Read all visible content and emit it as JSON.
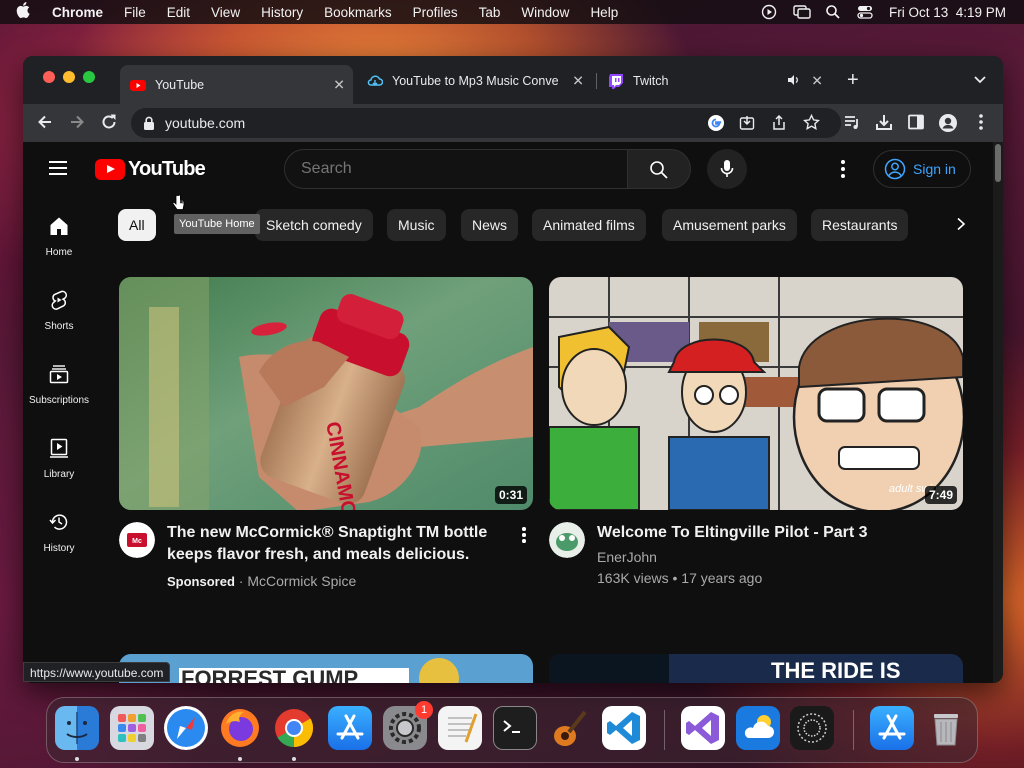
{
  "menubar": {
    "app": "Chrome",
    "items": [
      "File",
      "Edit",
      "View",
      "History",
      "Bookmarks",
      "Profiles",
      "Tab",
      "Window",
      "Help"
    ],
    "clock": "Fri Oct 13  4:19 PM"
  },
  "tabs": [
    {
      "title": "YouTube",
      "icon": "youtube-icon",
      "active": true
    },
    {
      "title": "YouTube to Mp3 Music Conve",
      "icon": "cloud-download-icon",
      "active": false
    },
    {
      "title": "Twitch",
      "icon": "twitch-icon",
      "active": false,
      "audio": true
    }
  ],
  "toolbar": {
    "url": "youtube.com"
  },
  "youtube": {
    "logo_text": "YouTube",
    "search_placeholder": "Search",
    "sign_in": "Sign in",
    "sidebar": [
      {
        "label": "Home",
        "icon": "home-icon"
      },
      {
        "label": "Shorts",
        "icon": "shorts-icon"
      },
      {
        "label": "Subscriptions",
        "icon": "subscriptions-icon"
      },
      {
        "label": "Library",
        "icon": "library-icon"
      },
      {
        "label": "History",
        "icon": "history-icon"
      }
    ],
    "chips": [
      "All",
      "Sketch comedy",
      "Music",
      "News",
      "Animated films",
      "Amusement parks",
      "Restaurants"
    ],
    "tooltip": "YouTube Home",
    "videos": [
      {
        "title": "The new McCormick® Snaptight TM bottle keeps flavor fresh, and meals delicious.",
        "duration": "0:31",
        "sponsored": "Sponsored",
        "channel": "McCormick Spice",
        "thumb_text": "CINNAMON"
      },
      {
        "title": "Welcome To Eltingville Pilot - Part 3",
        "duration": "7:49",
        "channel": "EnerJohn",
        "views": "163K views",
        "age": "17 years ago",
        "watermark": "adult swim"
      }
    ],
    "partial_thumbs": [
      "FORREST GUMP",
      "THE RIDE IS"
    ]
  },
  "status_bar_url": "https://www.youtube.com",
  "dock": {
    "apps": [
      "Finder",
      "Launchpad",
      "Safari",
      "Firefox",
      "Chrome",
      "App Store",
      "System Settings",
      "TextEdit",
      "Terminal",
      "GarageBand",
      "Visual Studio Code",
      "Visual Studio",
      "iCloud",
      "Geforce Filter",
      "App Store Downloads",
      "Trash"
    ],
    "settings_badge": "1"
  },
  "colors": {
    "yt_red": "#ff0000",
    "link_blue": "#3ea6ff",
    "chrome_dark": "#202124"
  }
}
